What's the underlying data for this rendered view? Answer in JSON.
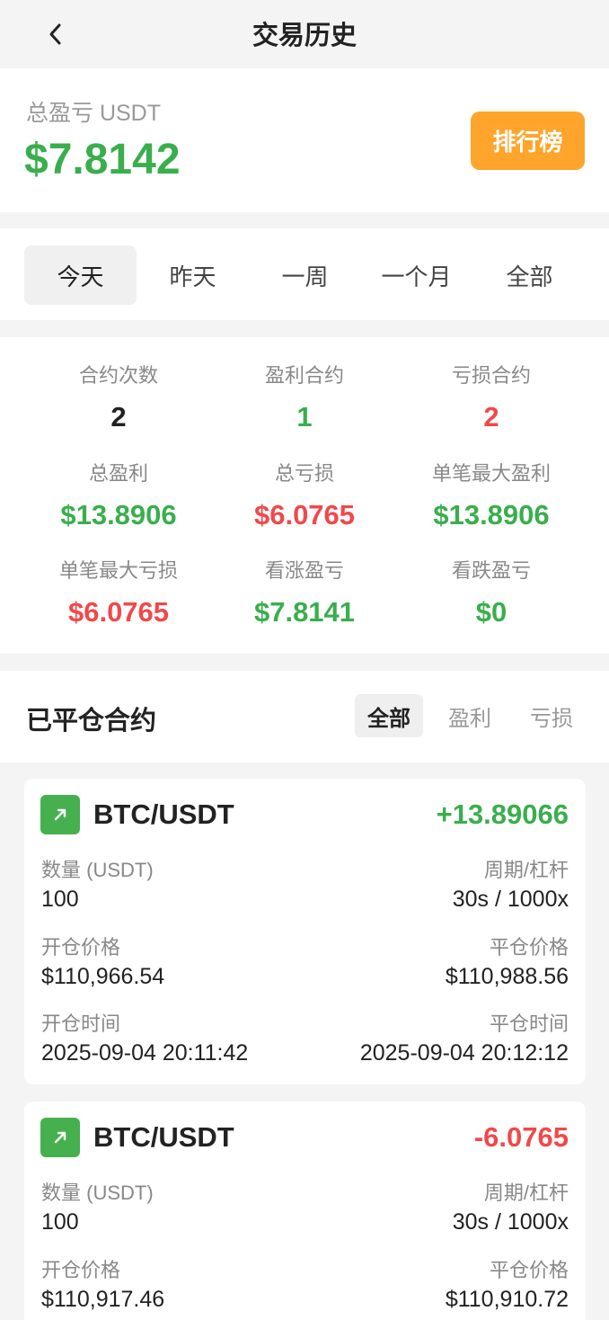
{
  "header": {
    "title": "交易历史"
  },
  "summary": {
    "label": "总盈亏 USDT",
    "value": "$7.8142",
    "rank_button": "排行榜"
  },
  "tabs": [
    {
      "label": "今天",
      "active": true
    },
    {
      "label": "昨天",
      "active": false
    },
    {
      "label": "一周",
      "active": false
    },
    {
      "label": "一个月",
      "active": false
    },
    {
      "label": "全部",
      "active": false
    }
  ],
  "stats": [
    {
      "label": "合约次数",
      "value": "2",
      "color": "#222222"
    },
    {
      "label": "盈利合约",
      "value": "1",
      "color": "#3aae4d"
    },
    {
      "label": "亏损合约",
      "value": "2",
      "color": "#f2484a"
    },
    {
      "label": "总盈利",
      "value": "$13.8906",
      "color": "#3aae4d"
    },
    {
      "label": "总亏损",
      "value": "$6.0765",
      "color": "#f2484a"
    },
    {
      "label": "单笔最大盈利",
      "value": "$13.8906",
      "color": "#3aae4d"
    },
    {
      "label": "单笔最大亏损",
      "value": "$6.0765",
      "color": "#f2484a"
    },
    {
      "label": "看涨盈亏",
      "value": "$7.8141",
      "color": "#3aae4d"
    },
    {
      "label": "看跌盈亏",
      "value": "$0",
      "color": "#3aae4d"
    }
  ],
  "closed": {
    "title": "已平仓合约",
    "filters": [
      {
        "label": "全部",
        "active": true
      },
      {
        "label": "盈利",
        "active": false
      },
      {
        "label": "亏损",
        "active": false
      }
    ]
  },
  "positions": [
    {
      "pair": "BTC/USDT",
      "pnl": "+13.89066",
      "pnl_color": "#3aae4d",
      "qty_label": "数量 (USDT)",
      "qty": "100",
      "period_label": "周期/杠杆",
      "period": "30s / 1000x",
      "open_price_label": "开仓价格",
      "open_price": "$110,966.54",
      "close_price_label": "平仓价格",
      "close_price": "$110,988.56",
      "open_time_label": "开仓时间",
      "open_time": "2025-09-04 20:11:42",
      "close_time_label": "平仓时间",
      "close_time": "2025-09-04 20:12:12"
    },
    {
      "pair": "BTC/USDT",
      "pnl": "-6.0765",
      "pnl_color": "#f2484a",
      "qty_label": "数量 (USDT)",
      "qty": "100",
      "period_label": "周期/杠杆",
      "period": "30s / 1000x",
      "open_price_label": "开仓价格",
      "open_price": "$110,917.46",
      "close_price_label": "平仓价格",
      "close_price": "$110,910.72"
    }
  ]
}
